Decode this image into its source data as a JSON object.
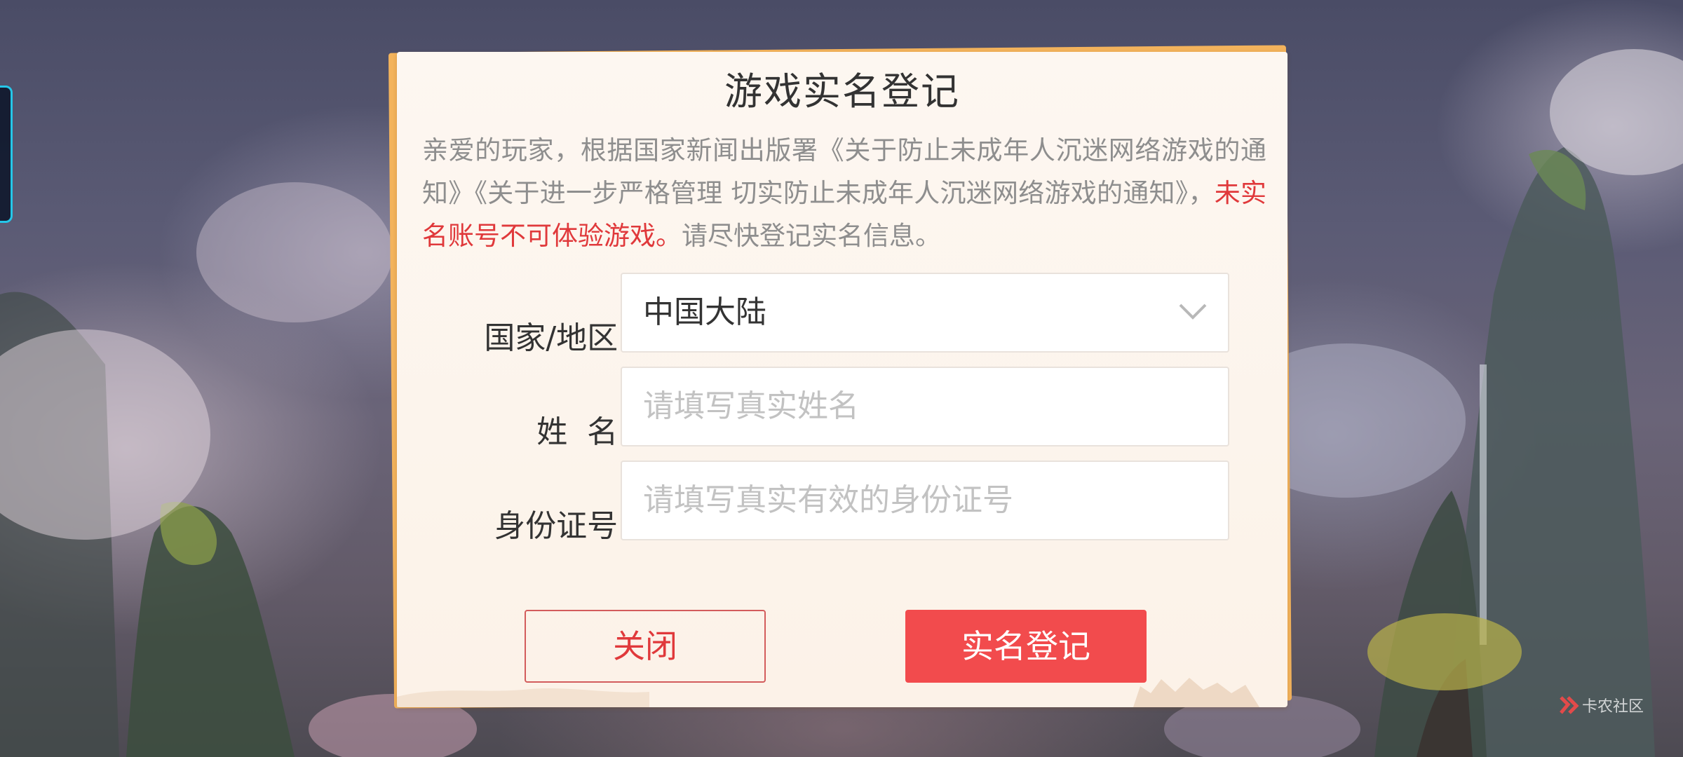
{
  "dialog": {
    "title": "游戏实名登记",
    "notice_prefix": "亲爱的玩家，根据国家新闻出版署《关于防止未成年人沉迷网络游戏的通知》《关于进一步严格管理 切实防止未成年人沉迷网络游戏的通知》，",
    "notice_warning": "未实名账号不可体验游戏。",
    "notice_suffix": "请尽快登记实名信息。",
    "warning_color": "#e0393b"
  },
  "form": {
    "region": {
      "label": "国家/地区:",
      "value": "中国大陆",
      "icon": "chevron-down-icon"
    },
    "name": {
      "label": "姓  名:",
      "value": "",
      "placeholder": "请填写真实姓名"
    },
    "id_number": {
      "label": "身份证号:",
      "value": "",
      "placeholder": "请填写真实有效的身份证号"
    }
  },
  "buttons": {
    "close_label": "关闭",
    "submit_label": "实名登记",
    "submit_color": "#f24b4d"
  },
  "watermark": {
    "text": "卡农社区",
    "icon": "kanong-logo-icon"
  }
}
